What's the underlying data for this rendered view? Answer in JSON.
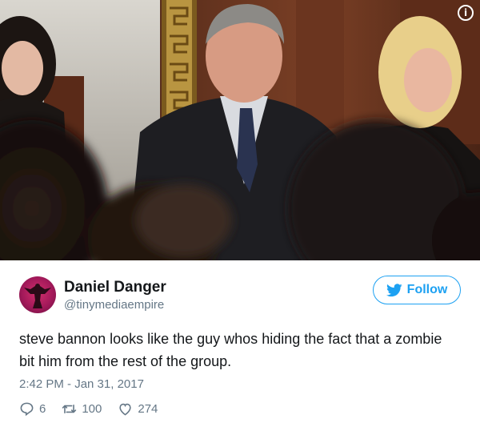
{
  "photo": {
    "alt": "",
    "info_icon": "info-icon",
    "info_glyph": "i"
  },
  "tweet": {
    "author": {
      "name": "Daniel Danger",
      "handle": "@tinymediaempire",
      "avatar_icon": "angel-statue-avatar"
    },
    "follow": {
      "label": "Follow",
      "icon": "bird-icon",
      "color": "#1da1f2"
    },
    "text": "steve bannon looks like the guy whos hiding the fact that a zombie bit him from the rest of the group.",
    "timestamp": "2:42 PM - Jan 31, 2017",
    "actions": {
      "reply_count": "6",
      "retweet_count": "100",
      "like_count": "274"
    }
  },
  "colors": {
    "accent": "#1da1f2",
    "secondary_text": "#657786",
    "primary_text": "#14171a"
  }
}
